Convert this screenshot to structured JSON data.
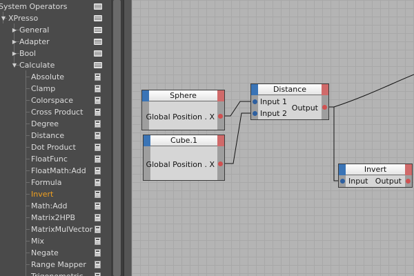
{
  "tree": {
    "items": [
      {
        "label": "System Operators",
        "icon": "folder-icon",
        "expanded": true
      },
      {
        "label": "XPresso",
        "icon": "folder-icon",
        "expanded": true
      },
      {
        "label": "General",
        "icon": "folder-icon",
        "expanded": false
      },
      {
        "label": "Adapter",
        "icon": "folder-icon",
        "expanded": false
      },
      {
        "label": "Bool",
        "icon": "folder-icon",
        "expanded": false
      },
      {
        "label": "Calculate",
        "icon": "folder-icon",
        "expanded": true
      },
      {
        "label": "Absolute",
        "icon": "calculator-icon"
      },
      {
        "label": "Clamp",
        "icon": "calculator-icon"
      },
      {
        "label": "Colorspace",
        "icon": "calculator-icon"
      },
      {
        "label": "Cross Product",
        "icon": "calculator-icon"
      },
      {
        "label": "Degree",
        "icon": "calculator-icon"
      },
      {
        "label": "Distance",
        "icon": "calculator-icon"
      },
      {
        "label": "Dot Product",
        "icon": "calculator-icon"
      },
      {
        "label": "FloatFunc",
        "icon": "calculator-icon"
      },
      {
        "label": "FloatMath:Add",
        "icon": "calculator-icon"
      },
      {
        "label": "Formula",
        "icon": "calculator-icon"
      },
      {
        "label": "Invert",
        "icon": "calculator-icon",
        "active": true
      },
      {
        "label": "Math:Add",
        "icon": "calculator-icon"
      },
      {
        "label": "Matrix2HPB",
        "icon": "calculator-icon"
      },
      {
        "label": "MatrixMulVector",
        "icon": "calculator-icon"
      },
      {
        "label": "Mix",
        "icon": "calculator-icon"
      },
      {
        "label": "Negate",
        "icon": "calculator-icon"
      },
      {
        "label": "Range Mapper",
        "icon": "calculator-icon"
      },
      {
        "label": "Trigonometric",
        "icon": "calculator-icon"
      }
    ]
  },
  "nodes": {
    "sphere": {
      "title": "Sphere",
      "port": "Global Position . X"
    },
    "cube": {
      "title": "Cube.1",
      "port": "Global Position . X"
    },
    "distance": {
      "title": "Distance",
      "input1": "Input 1",
      "input2": "Input 2",
      "output": "Output"
    },
    "invert": {
      "title": "Invert",
      "input": "Input",
      "output": "Output"
    }
  },
  "colors": {
    "active_item": "#f0a020",
    "input_tab": "#3a74b6",
    "output_tab": "#d06a6a"
  }
}
